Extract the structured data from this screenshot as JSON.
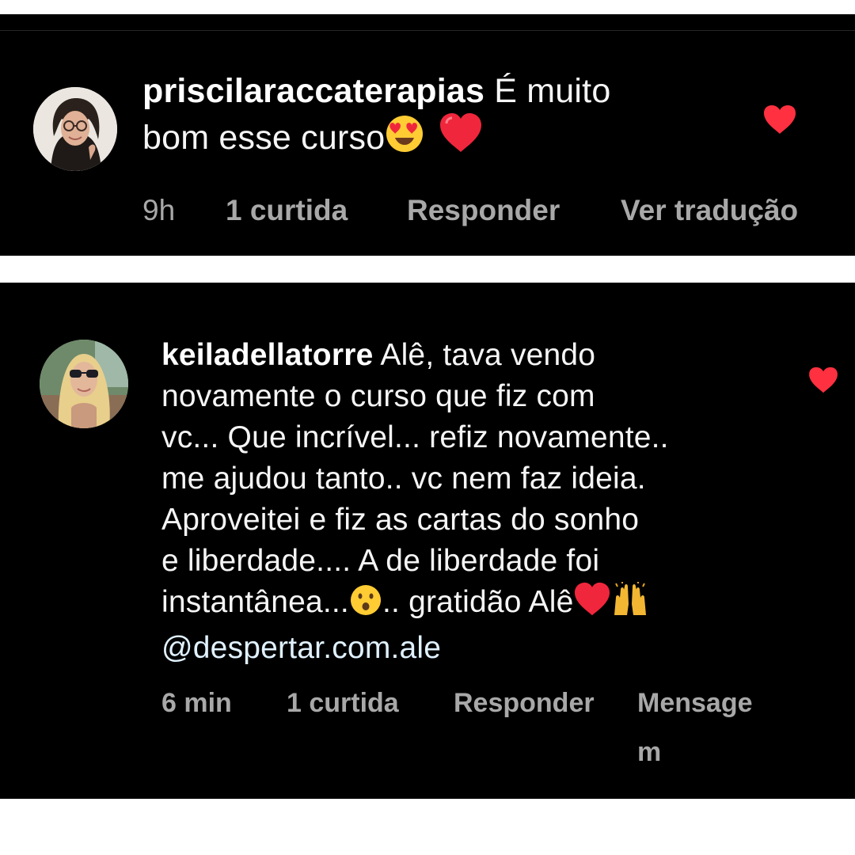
{
  "comments": [
    {
      "username": "priscilaraccaterapias",
      "text_line1_rest": " É muito",
      "text_line2": "bom esse curso",
      "time": "9h",
      "likes": "1 curtida",
      "reply_label": "Responder",
      "extra_action_label": "Ver tradução",
      "liked": true
    },
    {
      "username": "keiladellatorre",
      "text_line1_rest": " Alê, tava vendo",
      "text_lines": [
        "novamente o curso que fiz com",
        "vc... Que incrível... refiz novamente..",
        "me ajudou tanto.. vc nem faz ideia.",
        "Aproveitei e fiz as cartas do sonho",
        "e liberdade.... A de liberdade foi"
      ],
      "text_line7_a": "instantânea...",
      "text_line7_b": ".. gratidão Alê",
      "mention": "@despertar.com.ale",
      "time": "6 min",
      "likes": "1 curtida",
      "reply_label": "Responder",
      "extra_action_label": "Mensagem",
      "liked": true
    }
  ],
  "colors": {
    "background": "#000000",
    "frame": "#ffffff",
    "text": "#f5f5f5",
    "meta": "#a8a8a8",
    "like": "#ff3040",
    "mention": "#e0f1ff"
  },
  "icons": {
    "like": "heart-icon",
    "emoji_heart_eyes": "heart-eyes-emoji-icon",
    "emoji_heart": "red-heart-emoji-icon",
    "emoji_surprised": "hushed-face-emoji-icon",
    "emoji_raising_hands": "raising-hands-emoji-icon"
  }
}
